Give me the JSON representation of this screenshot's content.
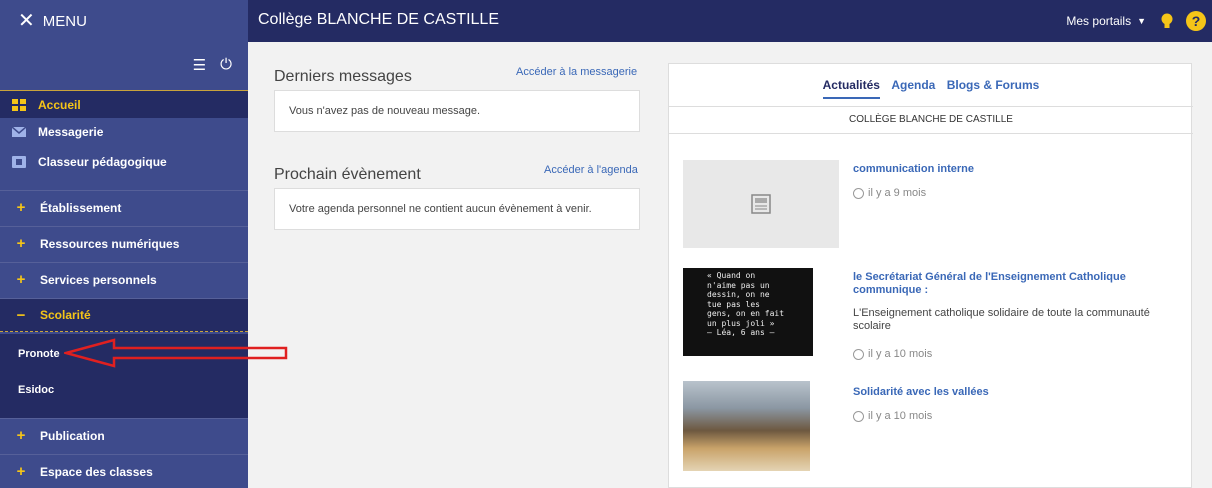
{
  "topbar": {
    "menu_label": "MENU",
    "school_name": "Collège BLANCHE DE CASTILLE",
    "portails_label": "Mes portails",
    "help_label": "?"
  },
  "sidebar": {
    "active_items": [
      {
        "label": "Accueil",
        "icon": "grid-icon"
      },
      {
        "label": "Messagerie",
        "icon": "envelope-icon"
      },
      {
        "label": "Classeur pédagogique",
        "icon": "binder-icon"
      }
    ],
    "sections": [
      {
        "sign": "+",
        "label": "Établissement"
      },
      {
        "sign": "+",
        "label": "Ressources numériques"
      },
      {
        "sign": "+",
        "label": "Services personnels"
      },
      {
        "sign": "−",
        "label": "Scolarité"
      },
      {
        "sign": "+",
        "label": "Publication"
      },
      {
        "sign": "+",
        "label": "Espace des classes"
      }
    ],
    "sub_items": [
      "Pronote",
      "Esidoc"
    ]
  },
  "main": {
    "messages": {
      "title": "Derniers messages",
      "link": "Accéder à la messagerie",
      "empty_text": "Vous n'avez pas de nouveau message."
    },
    "events": {
      "title": "Prochain évènement",
      "link": "Accéder à l'agenda",
      "empty_text": "Votre agenda personnel ne contient aucun évènement à venir."
    }
  },
  "panel": {
    "tabs": [
      "Actualités",
      "Agenda",
      "Blogs & Forums"
    ],
    "subtitle": "COLLÈGE BLANCHE DE CASTILLE",
    "news": [
      {
        "title": "communication interne",
        "time": "il y a 9 mois"
      },
      {
        "title": "le Secrétariat Général de l'Enseignement Catholique communique :",
        "desc": "L'Enseignement catholique solidaire de toute la communauté scolaire",
        "time": "il y a 10 mois",
        "image_text": "« Quand on\nn'aime pas un\ndessin, on ne\ntue pas les\ngens, on en fait\nun plus joli »\n– Léa, 6 ans –"
      },
      {
        "title": "Solidarité avec les vallées",
        "time": "il y a 10 mois"
      }
    ]
  },
  "colors": {
    "topbar": "#242b63",
    "sidebar": "#3e4b8c",
    "accent": "#f5c518",
    "link": "#3a68b7",
    "annotation_arrow": "#e02020"
  }
}
